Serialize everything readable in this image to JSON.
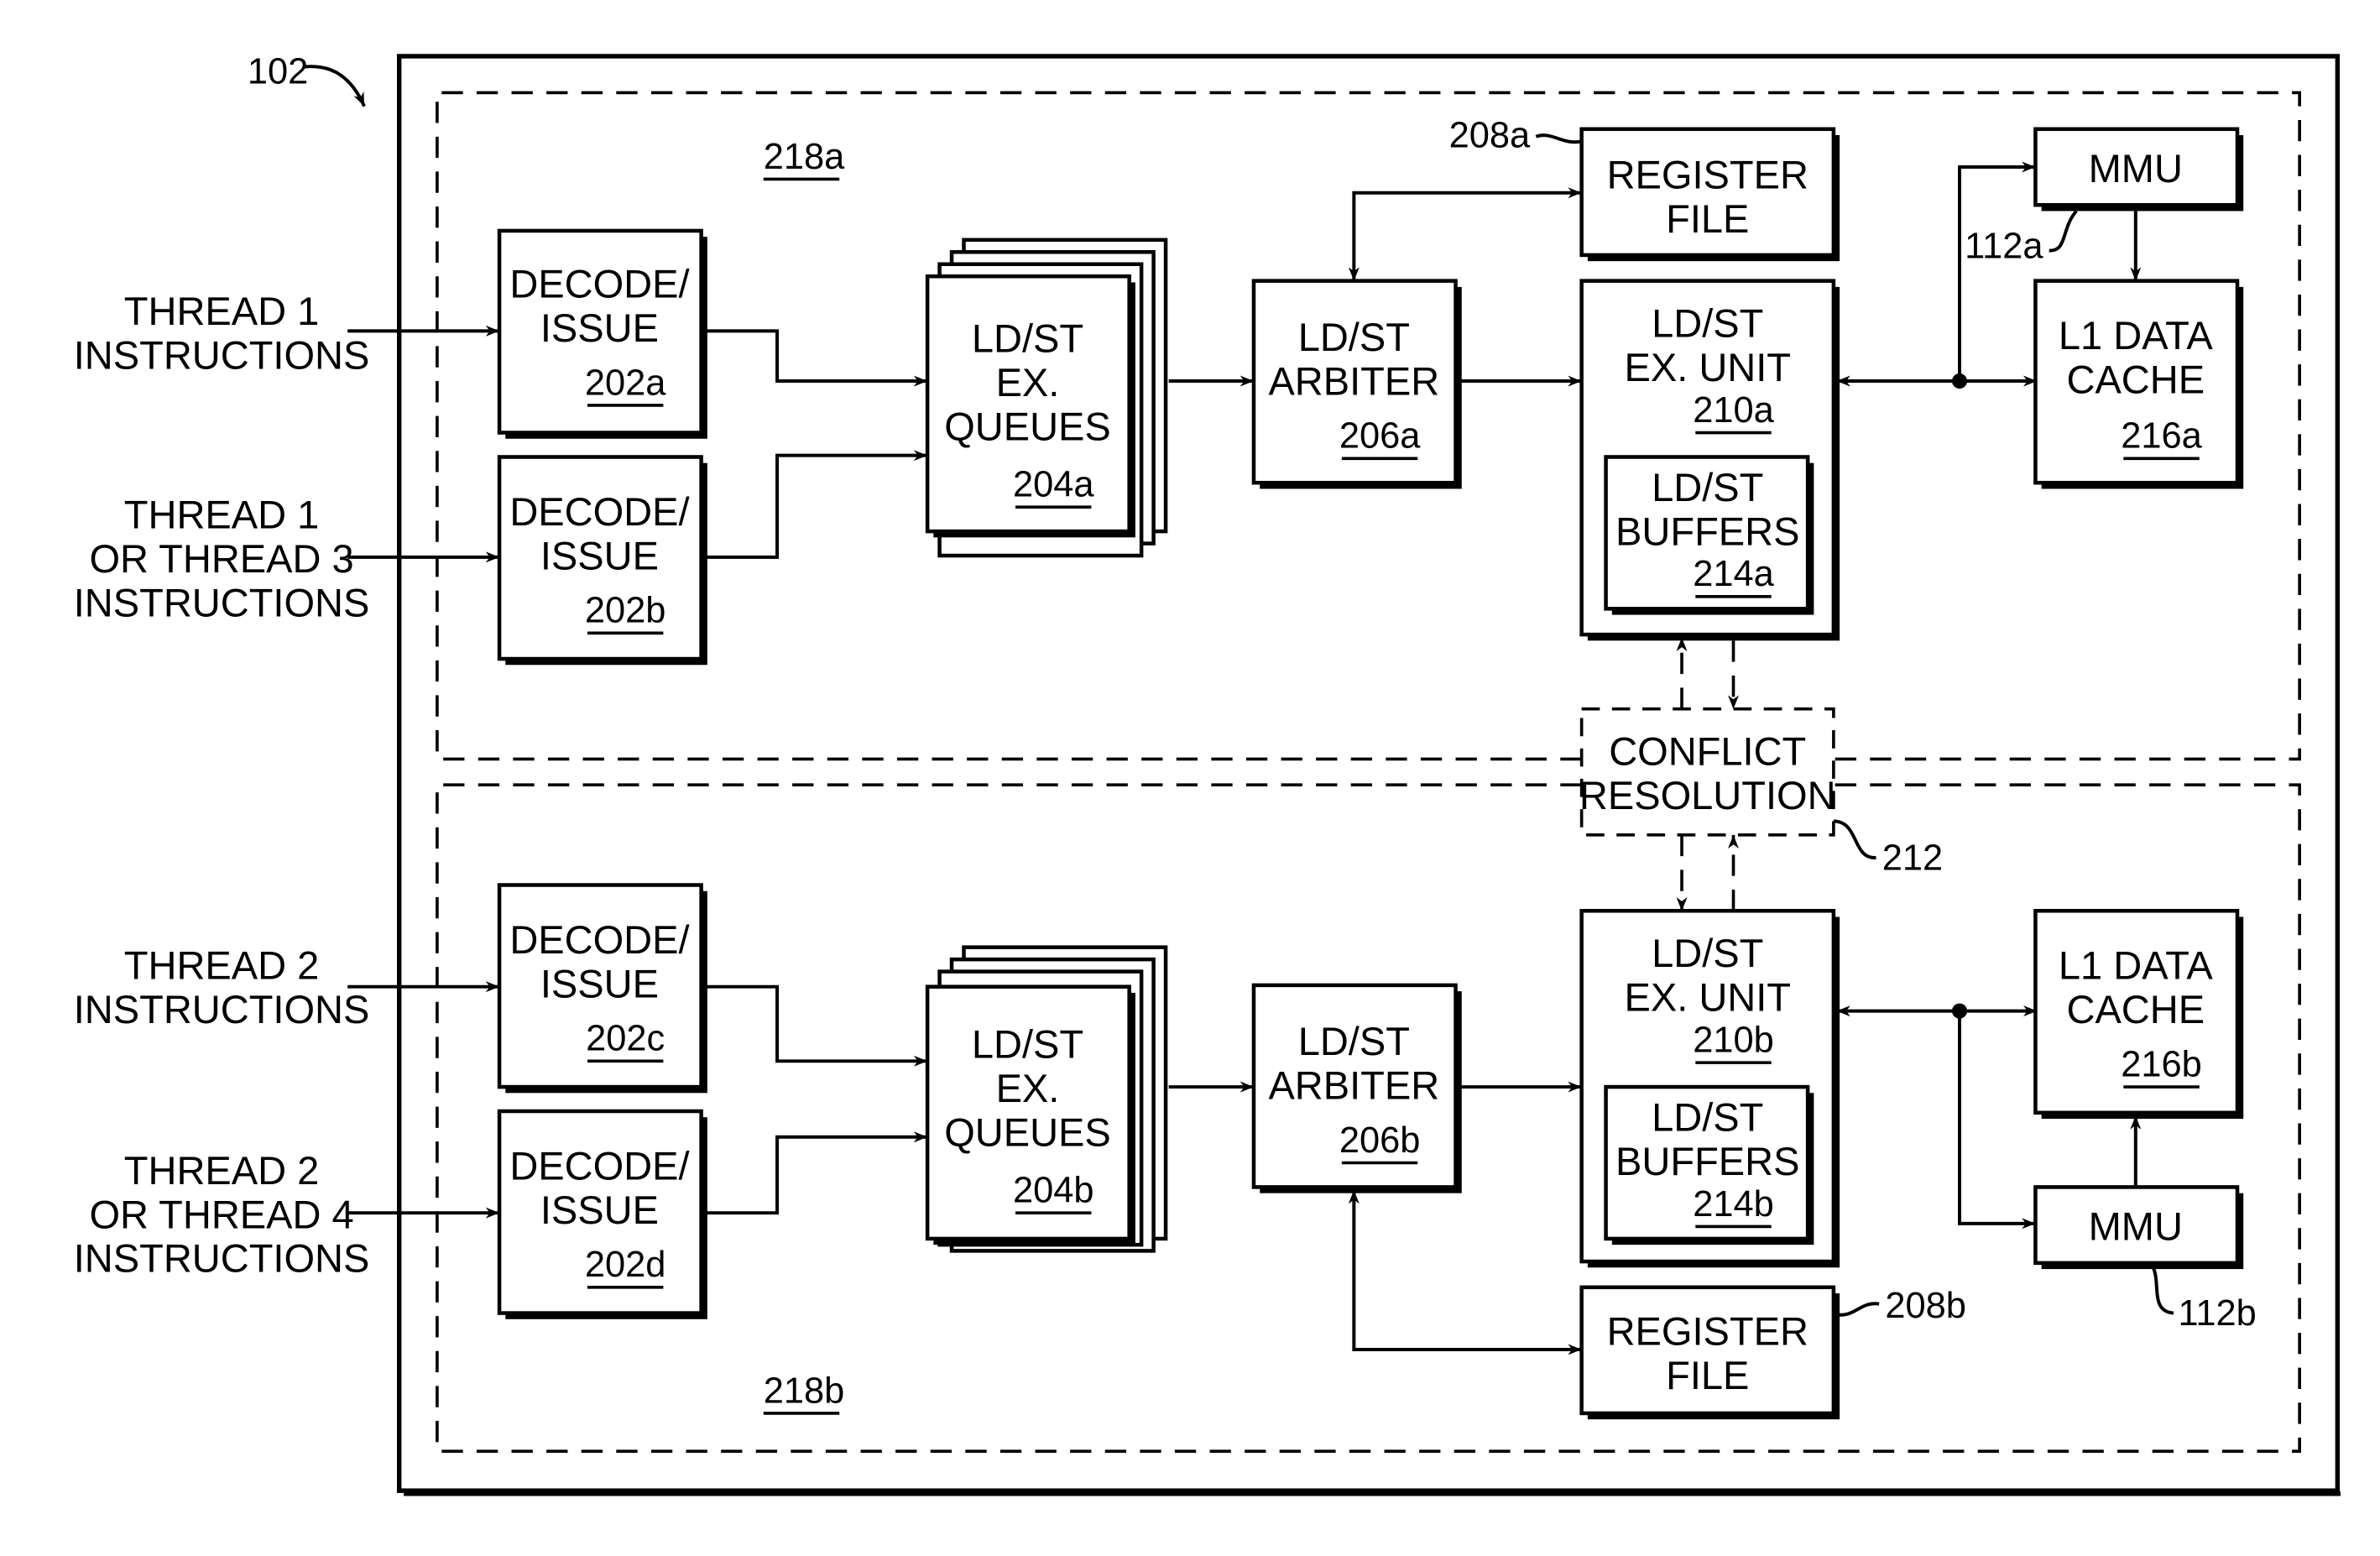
{
  "figure": {
    "ref": "102",
    "colors": {
      "ink": "#000000",
      "background": "#ffffff"
    }
  },
  "regions": {
    "top": {
      "ref": "218a"
    },
    "bottom": {
      "ref": "218b"
    }
  },
  "inputs": [
    {
      "lines": [
        "THREAD 1",
        "INSTRUCTIONS"
      ]
    },
    {
      "lines": [
        "THREAD 1",
        "OR THREAD 3",
        "INSTRUCTIONS"
      ]
    },
    {
      "lines": [
        "THREAD 2",
        "INSTRUCTIONS"
      ]
    },
    {
      "lines": [
        "THREAD 2",
        "OR THREAD 4",
        "INSTRUCTIONS"
      ]
    }
  ],
  "blocks": {
    "decode_a": {
      "lines": [
        "DECODE/",
        "ISSUE"
      ],
      "ref": "202a"
    },
    "decode_b": {
      "lines": [
        "DECODE/",
        "ISSUE"
      ],
      "ref": "202b"
    },
    "decode_c": {
      "lines": [
        "DECODE/",
        "ISSUE"
      ],
      "ref": "202c"
    },
    "decode_d": {
      "lines": [
        "DECODE/",
        "ISSUE"
      ],
      "ref": "202d"
    },
    "queues_a": {
      "lines": [
        "LD/ST",
        "EX.",
        "QUEUES"
      ],
      "ref": "204a"
    },
    "queues_b": {
      "lines": [
        "LD/ST",
        "EX.",
        "QUEUES"
      ],
      "ref": "204b"
    },
    "arbiter_a": {
      "lines": [
        "LD/ST",
        "ARBITER"
      ],
      "ref": "206a"
    },
    "arbiter_b": {
      "lines": [
        "LD/ST",
        "ARBITER"
      ],
      "ref": "206b"
    },
    "regfile_a": {
      "lines": [
        "REGISTER",
        "FILE"
      ],
      "ref": "208a"
    },
    "regfile_b": {
      "lines": [
        "REGISTER",
        "FILE"
      ],
      "ref": "208b"
    },
    "exunit_a": {
      "lines": [
        "LD/ST",
        "EX. UNIT"
      ],
      "ref": "210a"
    },
    "exunit_b": {
      "lines": [
        "LD/ST",
        "EX. UNIT"
      ],
      "ref": "210b"
    },
    "buffers_a": {
      "lines": [
        "LD/ST",
        "BUFFERS"
      ],
      "ref": "214a"
    },
    "buffers_b": {
      "lines": [
        "LD/ST",
        "BUFFERS"
      ],
      "ref": "214b"
    },
    "mmu_a": {
      "lines": [
        "MMU"
      ],
      "ref": "112a"
    },
    "mmu_b": {
      "lines": [
        "MMU"
      ],
      "ref": "112b"
    },
    "cache_a": {
      "lines": [
        "L1 DATA",
        "CACHE"
      ],
      "ref": "216a"
    },
    "cache_b": {
      "lines": [
        "L1 DATA",
        "CACHE"
      ],
      "ref": "216b"
    },
    "conflict": {
      "lines": [
        "CONFLICT",
        "RESOLUTION"
      ],
      "ref": "212"
    }
  }
}
